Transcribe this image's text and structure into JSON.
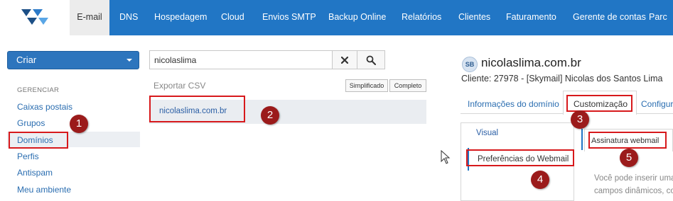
{
  "nav": {
    "items": [
      {
        "label": "E-mail",
        "active": true
      },
      {
        "label": "DNS"
      },
      {
        "label": "Hospedagem"
      },
      {
        "label": "Cloud"
      },
      {
        "label": "Envios SMTP"
      },
      {
        "label": "Backup Online"
      },
      {
        "label": "Relatórios"
      },
      {
        "label": "Clientes"
      },
      {
        "label": "Faturamento"
      },
      {
        "label": "Gerente de contas"
      },
      {
        "label": "Parc"
      }
    ]
  },
  "sidebar": {
    "create_label": "Criar",
    "section_title": "GERENCIAR",
    "items": [
      {
        "label": "Caixas postais"
      },
      {
        "label": "Grupos"
      },
      {
        "label": "Domínios",
        "active": true
      },
      {
        "label": "Perfis"
      },
      {
        "label": "Antispam"
      },
      {
        "label": "Meu ambiente"
      }
    ]
  },
  "search": {
    "value": "nicolaslima",
    "clear_icon": "close-icon",
    "search_icon": "search-icon"
  },
  "list": {
    "export_label": "Exportar CSV",
    "simplified_label": "Simplificado",
    "complete_label": "Completo",
    "results": [
      {
        "label": "nicolaslima.com.br"
      }
    ]
  },
  "detail": {
    "badge": "SB",
    "domain": "nicolaslima.com.br",
    "client_line": "Cliente: 27978 - [Skymail] Nicolas dos Santos Lima",
    "tabs": [
      {
        "label": "Informações do domínio"
      },
      {
        "label": "Customização",
        "active": true
      },
      {
        "label": "Configur"
      }
    ],
    "sub_items": [
      {
        "label": "Visual"
      },
      {
        "label": "Preferências do Webmail",
        "active": true
      }
    ],
    "sub_tab_label": "Assinatura webmail",
    "description_lines": [
      "Você pode inserir uma",
      "campos dinâmicos, co"
    ]
  },
  "annotations": [
    "1",
    "2",
    "3",
    "4",
    "5"
  ],
  "colors": {
    "nav_bg": "#2176c5",
    "highlight_red": "#d7191c",
    "marker_red": "#9b1b1b",
    "link_blue": "#2a6db0"
  }
}
